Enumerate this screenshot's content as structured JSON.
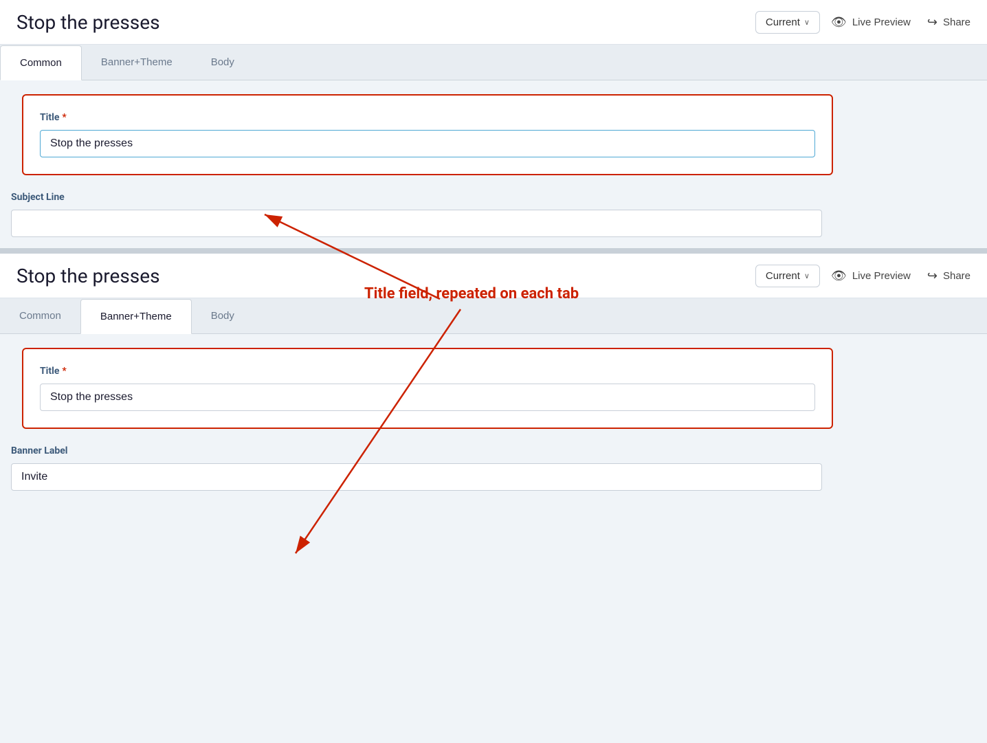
{
  "section1": {
    "header": {
      "title": "Stop the presses",
      "dropdown_label": "Current",
      "live_preview_label": "Live Preview",
      "share_label": "Share"
    },
    "tabs": [
      {
        "id": "common",
        "label": "Common",
        "active": true
      },
      {
        "id": "banner-theme",
        "label": "Banner+Theme",
        "active": false
      },
      {
        "id": "body",
        "label": "Body",
        "active": false
      }
    ],
    "title_field": {
      "label": "Title",
      "required": true,
      "value": "Stop the presses"
    },
    "subject_line_field": {
      "label": "Subject Line",
      "required": false,
      "value": "",
      "placeholder": ""
    }
  },
  "section2": {
    "header": {
      "title": "Stop the presses",
      "dropdown_label": "Current",
      "live_preview_label": "Live Preview",
      "share_label": "Share"
    },
    "tabs": [
      {
        "id": "common",
        "label": "Common",
        "active": false
      },
      {
        "id": "banner-theme",
        "label": "Banner+Theme",
        "active": true
      },
      {
        "id": "body",
        "label": "Body",
        "active": false
      }
    ],
    "title_field": {
      "label": "Title",
      "required": true,
      "value": "Stop the presses"
    },
    "banner_label_field": {
      "label": "Banner Label",
      "required": false,
      "value": "Invite",
      "placeholder": ""
    }
  },
  "annotation": {
    "text": "Title field, repeated on each tab"
  },
  "icons": {
    "eye": "👁",
    "share": "↪",
    "chevron": "∨"
  }
}
